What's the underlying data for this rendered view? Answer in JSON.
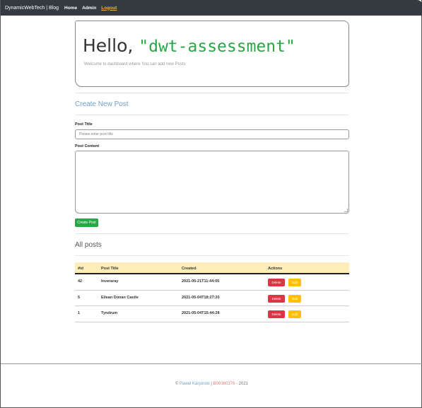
{
  "navbar": {
    "brand": "DynamicWebTech | Blog",
    "links": [
      "Home",
      "Admin",
      "Logout"
    ]
  },
  "jumbotron": {
    "greeting_prefix": "Hello, ",
    "username": "\"dwt-assessment\"",
    "lead": "Welcome to dashboard where You can add new Posts"
  },
  "create": {
    "heading": "Create New Post",
    "title_label": "Post Title",
    "title_placeholder": "Please enter post title",
    "content_label": "Post Content",
    "submit_label": "Create Post"
  },
  "posts": {
    "heading": "All posts",
    "columns": [
      "#id",
      "Post Title",
      "Created",
      "Actions"
    ],
    "rows": [
      {
        "id": "42",
        "title": "Inveraray",
        "created": "2021-05-21T11:44:05"
      },
      {
        "id": "5",
        "title": "Eilean Donan Castle",
        "created": "2021-05-04T18:27:20"
      },
      {
        "id": "1",
        "title": "Tyndrum",
        "created": "2021-05-04T15:44:28"
      }
    ],
    "delete_label": "Delete",
    "edit_label": "Edit"
  },
  "footer": {
    "copyright": "© ",
    "author": "Pawel Karpinski",
    "sep": " | ",
    "student_id": "B00360376",
    "year": " - 2021"
  },
  "colors": {
    "navbar": "#343a40",
    "success": "#28a745",
    "danger": "#dc3545",
    "warning": "#ffc107",
    "table_header": "#ffeeba"
  }
}
